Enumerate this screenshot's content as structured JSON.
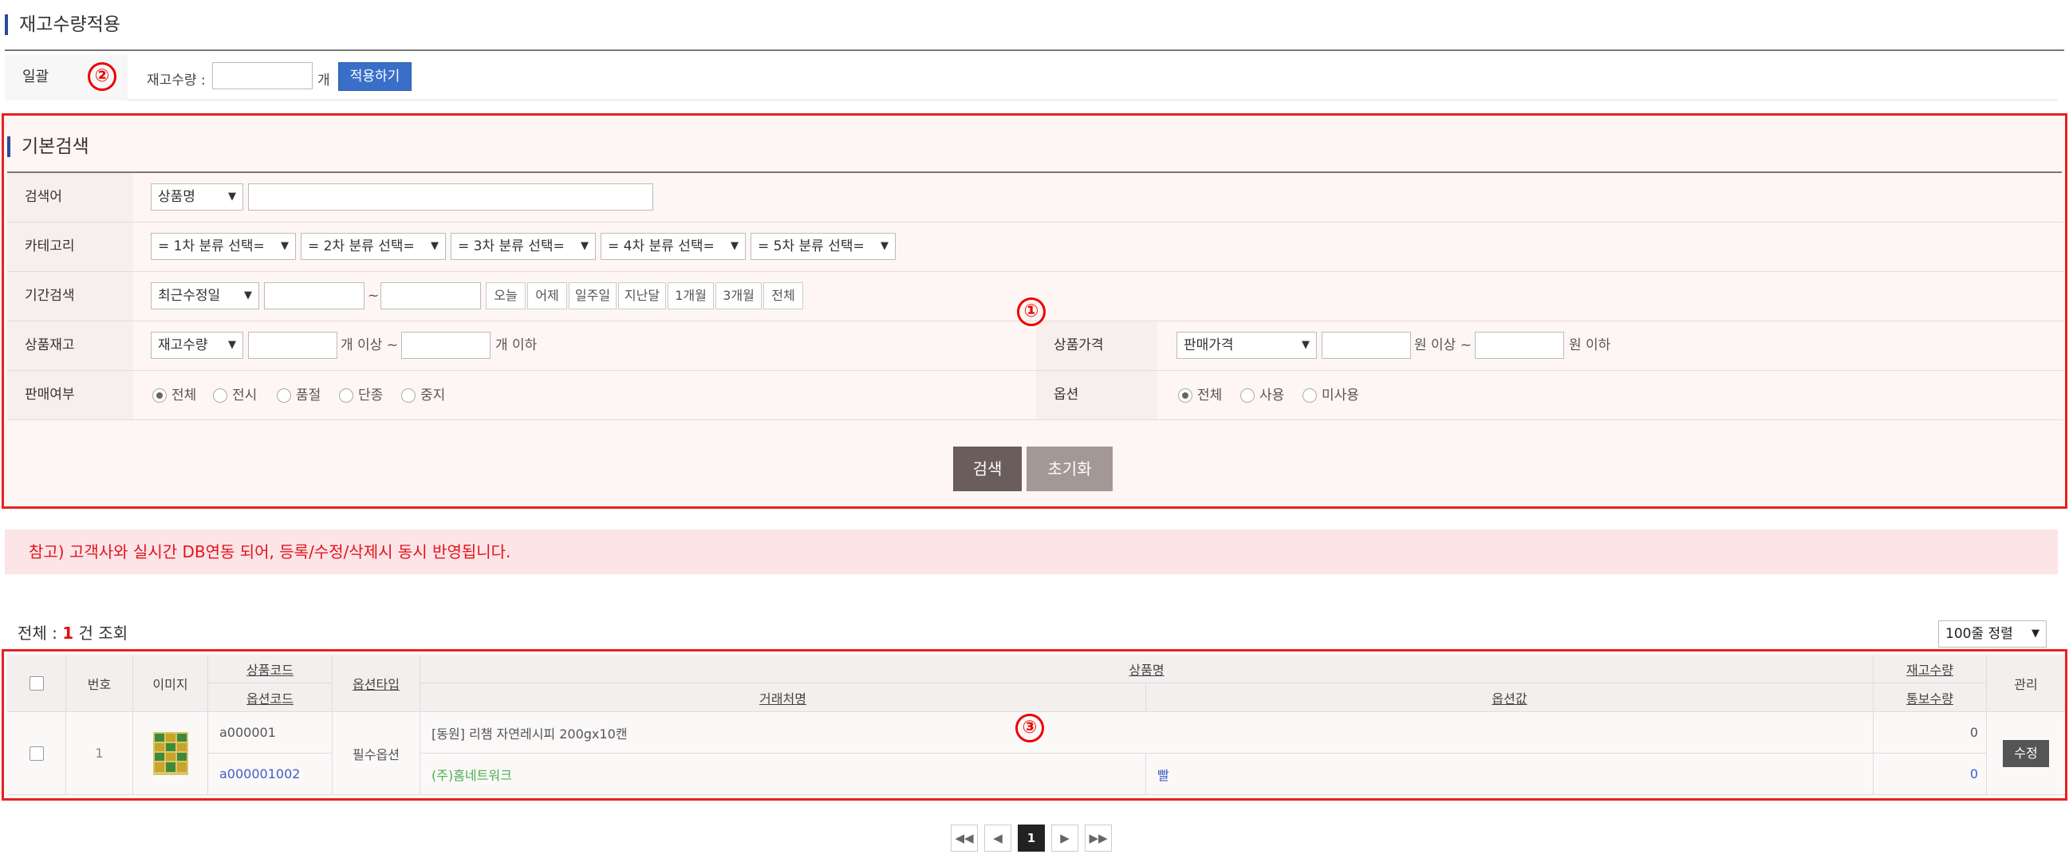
{
  "stock_apply": {
    "title": "재고수량적용",
    "bulk_label": "일괄",
    "marker": "②",
    "qty_label": "재고수량 :",
    "unit": "개",
    "apply_button": "적용하기"
  },
  "basic_search": {
    "title": "기본검색",
    "marker": "①",
    "keyword": {
      "label": "검색어",
      "select": "상품명"
    },
    "category": {
      "label": "카테고리",
      "selects": [
        "= 1차 분류 선택=",
        "= 2차 분류 선택=",
        "= 3차 분류 선택=",
        "= 4차 분류 선택=",
        "= 5차 분류 선택="
      ]
    },
    "period": {
      "label": "기간검색",
      "select": "최근수정일",
      "tilde": "~",
      "quick_buttons": [
        "오늘",
        "어제",
        "일주일",
        "지난달",
        "1개월",
        "3개월",
        "전체"
      ]
    },
    "stock": {
      "label": "상품재고",
      "select": "재고수량",
      "min_suffix": "개 이상 ~",
      "max_suffix": "개 이하"
    },
    "price": {
      "label": "상품가격",
      "select": "판매가격",
      "min_suffix": "원 이상 ~",
      "max_suffix": "원 이하"
    },
    "sale_status": {
      "label": "판매여부",
      "options": [
        "전체",
        "전시",
        "품절",
        "단종",
        "중지"
      ],
      "selected": "전체"
    },
    "option": {
      "label": "옵션",
      "options": [
        "전체",
        "사용",
        "미사용"
      ],
      "selected": "전체"
    },
    "search_button": "검색",
    "reset_button": "초기화"
  },
  "notice": "참고) 고객사와 실시간 DB연동 되어, 등록/수정/삭제시 동시 반영됩니다.",
  "results": {
    "total_prefix": "전체 : ",
    "total_count": "1",
    "total_suffix": " 건 조회",
    "sort_select": "100줄 정렬",
    "marker": "③"
  },
  "table": {
    "headers": {
      "no": "번호",
      "image": "이미지",
      "product_code": "상품코드",
      "option_code": "옵션코드",
      "option_type": "옵션타입",
      "product_name": "상품명",
      "supplier": "거래처명",
      "option_value": "옵션값",
      "stock_qty": "재고수량",
      "alert_qty": "통보수량",
      "manage": "관리"
    },
    "rows": [
      {
        "no": "1",
        "product_code": "a000001",
        "option_code": "a000001002",
        "option_type": "필수옵션",
        "product_name": "[동원] 리챔 자연레시피 200gx10캔",
        "supplier": "(주)홈네트워크",
        "option_value": "빨",
        "stock_qty": "0",
        "alert_qty": "0",
        "edit_button": "수정"
      }
    ]
  },
  "pagination": {
    "first": "◀◀",
    "prev": "◀",
    "current": "1",
    "next": "▶",
    "last": "▶▶"
  },
  "colors": {
    "highlight_border": "#e52222",
    "notice_bg": "#fde4e6",
    "notice_text": "#e1141e",
    "apply_button": "#3a6fc9",
    "search_button": "#6a5d5b",
    "reset_button": "#a39896"
  }
}
